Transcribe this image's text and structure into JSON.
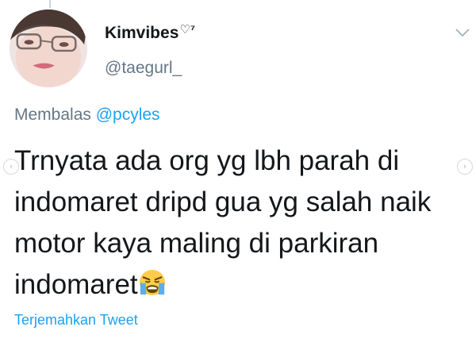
{
  "tweet": {
    "display_name": "Kimvibes",
    "name_badge": "♡⁷",
    "handle": "@taegurl_",
    "reply_prefix": "Membalas",
    "reply_mention": "@pcyles",
    "text": "Trnyata ada org yg lbh parah di indomaret dripd gua yg salah naik motor kaya maling di parkiran indomaret",
    "emoji": "loudly-crying-face-emoji",
    "translate_link": "Terjemahkan Tweet"
  },
  "icons": {
    "menu": "chevron-down-icon",
    "prev": "chevron-left-icon",
    "next": "chevron-right-icon"
  },
  "colors": {
    "link": "#1da1f2",
    "secondary_text": "#657786",
    "primary_text": "#14171a"
  }
}
